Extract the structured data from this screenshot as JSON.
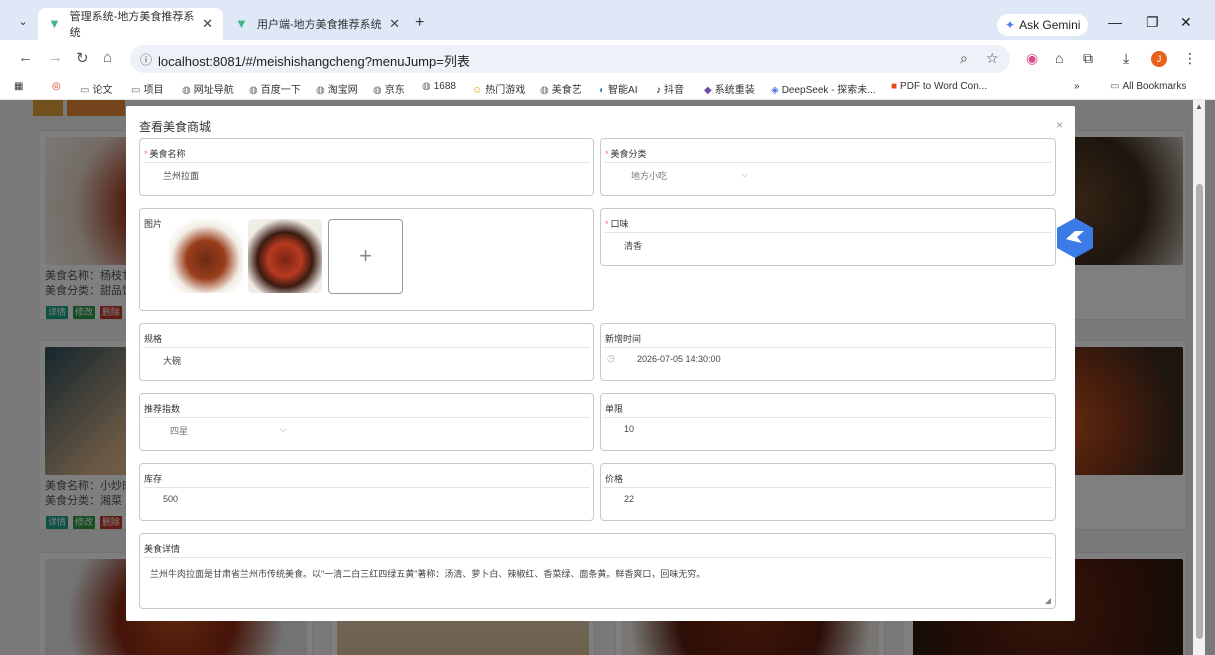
{
  "browser": {
    "tabs": [
      {
        "title": "管理系统-地方美食推荐系统",
        "active": true
      },
      {
        "title": "用户端-地方美食推荐系统",
        "active": false
      }
    ],
    "ask_gemini": "Ask Gemini",
    "url": "localhost:8081/#/meishishangcheng?menuJump=列表",
    "bookmarks": [
      "论文",
      "项目",
      "网址导航",
      "百度一下",
      "淘宝网",
      "京东",
      "1688",
      "热门游戏",
      "美食艺",
      "智能AI",
      "抖音",
      "系统重装",
      "DeepSeek - 探索未...",
      "PDF to Word Con..."
    ],
    "bookmarks_overflow": "»",
    "all_bookmarks": "All Bookmarks"
  },
  "background": {
    "cards": [
      {
        "name_label": "美食名称：杨枝甘",
        "category_label": "美食分类：甜品饮"
      },
      {
        "name_label": "美食名称：小炒肉",
        "category_label": "美食分类：湘菜"
      }
    ],
    "buttons": {
      "detail": "详情",
      "edit": "修改",
      "delete": "删除"
    }
  },
  "dialog": {
    "title": "查看美食商城",
    "close": "×",
    "fields": {
      "name": {
        "label": "美食名称",
        "value": "兰州拉面",
        "required": true
      },
      "category": {
        "label": "美食分类",
        "value": "地方小吃",
        "required": true
      },
      "images": {
        "label": "图片",
        "upload": "+"
      },
      "taste": {
        "label": "口味",
        "value": "清香",
        "required": true
      },
      "spec": {
        "label": "规格",
        "value": "大碗"
      },
      "added_time": {
        "label": "新增时间",
        "value": "2026-07-05 14:30:00"
      },
      "rating": {
        "label": "推荐指数",
        "value": "四星"
      },
      "limit": {
        "label": "单限",
        "value": "10"
      },
      "stock": {
        "label": "库存",
        "value": "500"
      },
      "price": {
        "label": "价格",
        "value": "22"
      },
      "detail": {
        "label": "美食详情",
        "value": "兰州牛肉拉面是甘肃省兰州市传统美食。以\"一清二白三红四绿五黄\"著称：汤清、萝卜白、辣椒红、香菜绿、面条黄。鲜香爽口，回味无穷。"
      }
    }
  },
  "colors": {
    "required": "#f56c6c",
    "btn_detail": "#17a589",
    "btn_edit": "#2e9d49",
    "btn_delete": "#c0392b",
    "vue_green": "#41b883"
  }
}
